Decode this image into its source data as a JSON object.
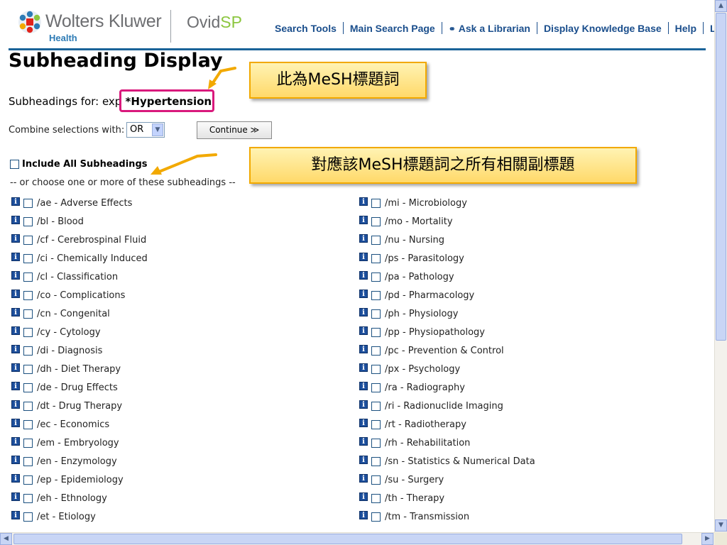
{
  "header": {
    "brand": "Wolters Kluwer",
    "brand_sub": "Health",
    "product_prefix": "Ovid",
    "product_suffix": "SP",
    "nav": [
      "Search Tools",
      "Main Search Page",
      "Ask a Librarian",
      "Display Knowledge Base",
      "Help",
      "Logoff"
    ]
  },
  "page": {
    "title": "Subheading Display",
    "subheadings_for_label": "Subheadings for: exp",
    "term": " *Hypertension",
    "combine_label": "Combine selections with:",
    "combine_value": "OR",
    "continue_label": "Continue ≫",
    "include_all_label": "Include All Subheadings",
    "or_choose_label": "-- or choose one or more of these subheadings --"
  },
  "callouts": {
    "term_note": "此為MeSH標題詞",
    "subheading_note": "對應該MeSH標題詞之所有相關副標題"
  },
  "subheadings": {
    "left": [
      "/ae - Adverse Effects",
      "/bl - Blood",
      "/cf - Cerebrospinal Fluid",
      "/ci - Chemically Induced",
      "/cl - Classification",
      "/co - Complications",
      "/cn - Congenital",
      "/cy - Cytology",
      "/di - Diagnosis",
      "/dh - Diet Therapy",
      "/de - Drug Effects",
      "/dt - Drug Therapy",
      "/ec - Economics",
      "/em - Embryology",
      "/en - Enzymology",
      "/ep - Epidemiology",
      "/eh - Ethnology",
      "/et - Etiology"
    ],
    "right": [
      "/mi - Microbiology",
      "/mo - Mortality",
      "/nu - Nursing",
      "/ps - Parasitology",
      "/pa - Pathology",
      "/pd - Pharmacology",
      "/ph - Physiology",
      "/pp - Physiopathology",
      "/pc - Prevention & Control",
      "/px - Psychology",
      "/ra - Radiography",
      "/ri - Radionuclide Imaging",
      "/rt - Radiotherapy",
      "/rh - Rehabilitation",
      "/sn - Statistics & Numerical Data",
      "/su - Surgery",
      "/th - Therapy",
      "/tm - Transmission"
    ]
  },
  "icons": {
    "info": "info-icon",
    "librarian": "librarian-icon",
    "logo": "wolters-kluwer-logo-icon"
  },
  "colors": {
    "nav": "#1a4e8c",
    "rule": "#1a6399",
    "highlight": "#d9197c",
    "callout_border": "#f2a900",
    "brand_green": "#8cc63f"
  }
}
